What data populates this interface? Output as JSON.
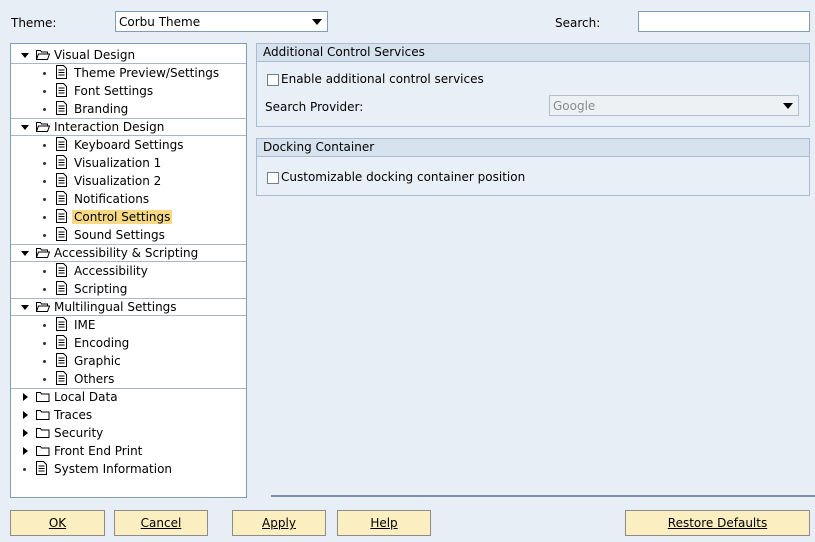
{
  "top": {
    "theme_label": "Theme:",
    "theme_value": "Corbu Theme",
    "search_label": "Search:",
    "search_value": ""
  },
  "tree": {
    "groups": [
      {
        "label": "Visual Design",
        "items": [
          "Theme Preview/Settings",
          "Font Settings",
          "Branding"
        ]
      },
      {
        "label": "Interaction Design",
        "items": [
          "Keyboard Settings",
          "Visualization 1",
          "Visualization 2",
          "Notifications",
          "Control Settings",
          "Sound Settings"
        ]
      },
      {
        "label": "Accessibility & Scripting",
        "items": [
          "Accessibility",
          "Scripting"
        ]
      },
      {
        "label": "Multilingual Settings",
        "items": [
          "IME",
          "Encoding",
          "Graphic",
          "Others"
        ]
      }
    ],
    "collapsed": [
      "Local Data",
      "Traces",
      "Security",
      "Front End Print"
    ],
    "leaf": "System Information",
    "selected": "Control Settings"
  },
  "panels": {
    "acs": {
      "title": "Additional Control Services",
      "enable_label": "Enable additional control services",
      "provider_label": "Search Provider:",
      "provider_value": "Google"
    },
    "dock": {
      "title": "Docking Container",
      "custom_label": "Customizable docking container position"
    }
  },
  "buttons": {
    "ok": "OK",
    "cancel": "Cancel",
    "apply": "Apply",
    "help": "Help",
    "restore": "Restore Defaults"
  },
  "colors": {
    "selection": "#f7d883",
    "button_face": "#fbeec0",
    "panel_header": "#d6e2ee"
  }
}
